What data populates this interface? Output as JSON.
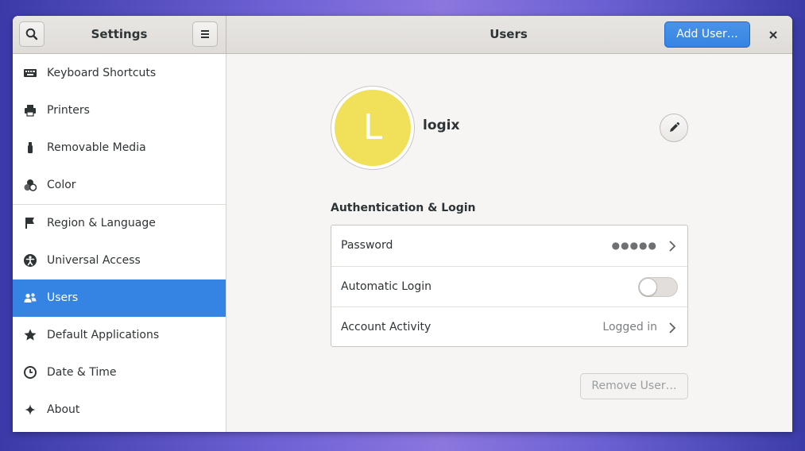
{
  "header": {
    "left_title": "Settings",
    "title": "Users",
    "add_user_label": "Add User…"
  },
  "sidebar": {
    "items": [
      {
        "label": "Keyboard Shortcuts",
        "icon": "keyboard-icon"
      },
      {
        "label": "Printers",
        "icon": "printer-icon"
      },
      {
        "label": "Removable Media",
        "icon": "usb-drive-icon"
      },
      {
        "label": "Color",
        "icon": "color-icon"
      },
      {
        "label": "Region & Language",
        "icon": "flag-icon"
      },
      {
        "label": "Universal Access",
        "icon": "accessibility-icon"
      },
      {
        "label": "Users",
        "icon": "users-icon",
        "selected": true
      },
      {
        "label": "Default Applications",
        "icon": "star-icon"
      },
      {
        "label": "Date & Time",
        "icon": "clock-icon"
      },
      {
        "label": "About",
        "icon": "sparkle-icon"
      }
    ]
  },
  "user": {
    "avatar_initial": "L",
    "avatar_color": "#f1e05a",
    "name": "logix"
  },
  "auth": {
    "section_title": "Authentication & Login",
    "password_label": "Password",
    "password_value": "●●●●●",
    "auto_login_label": "Automatic Login",
    "auto_login_enabled": false,
    "activity_label": "Account Activity",
    "activity_value": "Logged in"
  },
  "remove_user_label": "Remove User…",
  "colors": {
    "accent": "#3584e4"
  }
}
